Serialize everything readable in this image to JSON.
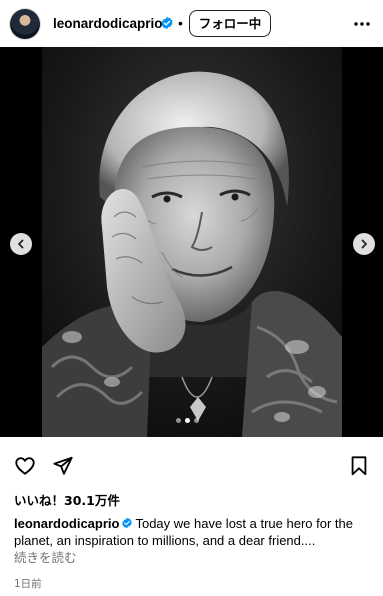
{
  "header": {
    "username": "leonardodicaprio",
    "separator": "•",
    "follow_label": "フォロー中"
  },
  "media": {
    "carousel_total": 3,
    "carousel_current": 2,
    "icons": [
      "chevron-left-icon",
      "chevron-right-icon"
    ]
  },
  "actions": {
    "icons": [
      "heart-icon",
      "share-icon",
      "bookmark-icon"
    ]
  },
  "likes_label": "いいね！30.1万件",
  "caption": {
    "username": "leonardodicaprio",
    "text": "Today we have lost a true hero for the planet, an inspiration to millions, and a dear friend....",
    "read_more": "続きを読む"
  },
  "timestamp": "1日前",
  "colors": {
    "verified": "#0095f6",
    "secondary_text": "#737373",
    "media_background": "#000000"
  }
}
